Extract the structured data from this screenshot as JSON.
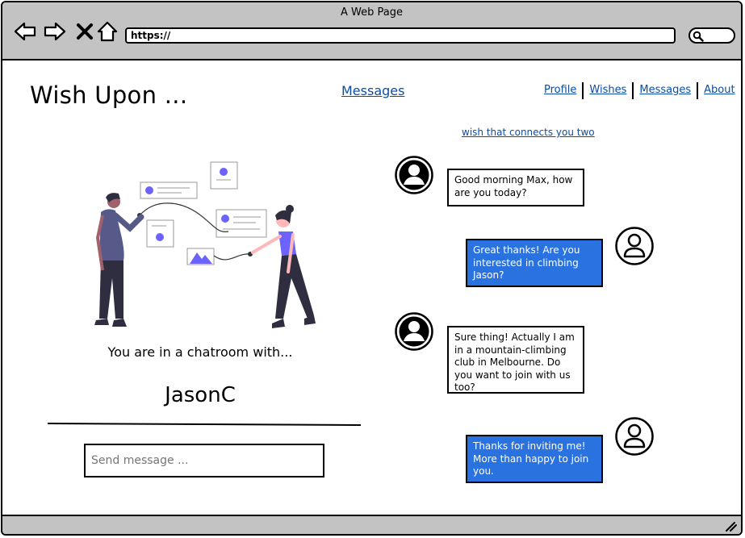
{
  "window": {
    "title": "A Web Page"
  },
  "browser": {
    "url": "https://"
  },
  "header": {
    "brand": "Wish Upon ...",
    "center_link": "Messages",
    "nav": [
      "Profile",
      "Wishes",
      "Messages",
      "About"
    ]
  },
  "subheader_link": "wish that connects you two",
  "chatroom": {
    "intro": "You are in a chatroom with...",
    "partner": "JasonC",
    "input_placeholder": "Send message ..."
  },
  "messages": [
    {
      "direction": "incoming",
      "text": "Good morning Max, how are you today?"
    },
    {
      "direction": "outgoing",
      "text": "Great thanks! Are you interested in climbing Jason?"
    },
    {
      "direction": "incoming",
      "text": "Sure thing! Actually I am in a mountain-climbing club in Melbourne. Do you want to join with us too?"
    },
    {
      "direction": "outgoing",
      "text": "Thanks for inviting me! More than happy to join you."
    }
  ],
  "colors": {
    "link": "#0a4da6",
    "outgoing_bubble": "#2a72e0",
    "chrome": "#c3c3c3",
    "illustration_accent": "#6c63ff"
  }
}
